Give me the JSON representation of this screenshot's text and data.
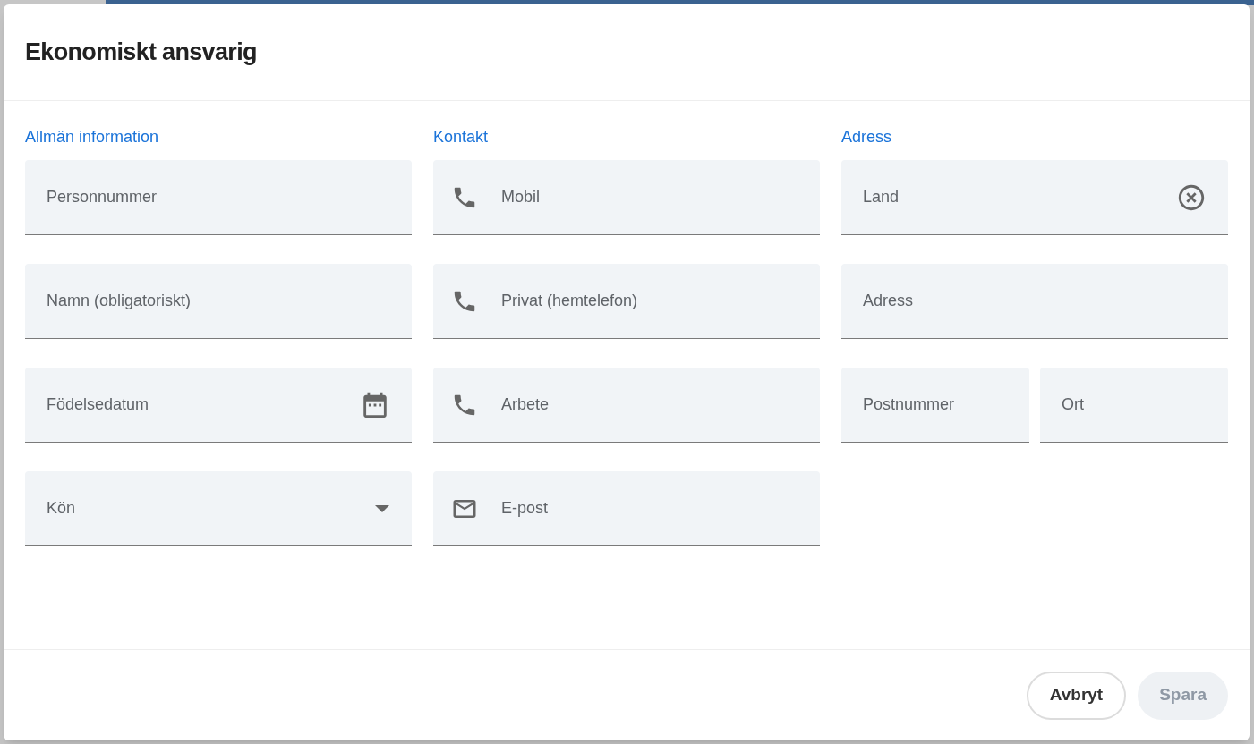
{
  "dialog": {
    "title": "Ekonomiskt ansvarig"
  },
  "sections": [
    {
      "heading": "Allmän information",
      "rows": [
        [
          {
            "placeholder": "Personnummer",
            "kind": "text"
          }
        ],
        [
          {
            "placeholder": "Namn (obligatoriskt)",
            "kind": "text"
          }
        ],
        [
          {
            "placeholder": "Födelsedatum",
            "kind": "date"
          }
        ],
        [
          {
            "placeholder": "Kön",
            "kind": "select"
          }
        ]
      ]
    },
    {
      "heading": "Kontakt",
      "rows": [
        [
          {
            "placeholder": "Mobil",
            "kind": "phone"
          }
        ],
        [
          {
            "placeholder": "Privat (hemtelefon)",
            "kind": "phone"
          }
        ],
        [
          {
            "placeholder": "Arbete",
            "kind": "phone"
          }
        ],
        [
          {
            "placeholder": "E-post",
            "kind": "email"
          }
        ]
      ]
    },
    {
      "heading": "Adress",
      "rows": [
        [
          {
            "placeholder": "Land",
            "kind": "clearable"
          }
        ],
        [
          {
            "placeholder": "Adress",
            "kind": "text"
          }
        ],
        [
          {
            "placeholder": "Postnummer",
            "kind": "text"
          },
          {
            "placeholder": "Ort",
            "kind": "text"
          }
        ]
      ]
    }
  ],
  "buttons": [
    {
      "label": "Avbryt",
      "kind": "outline",
      "disabled": false
    },
    {
      "label": "Spara",
      "kind": "filled",
      "disabled": true
    }
  ]
}
